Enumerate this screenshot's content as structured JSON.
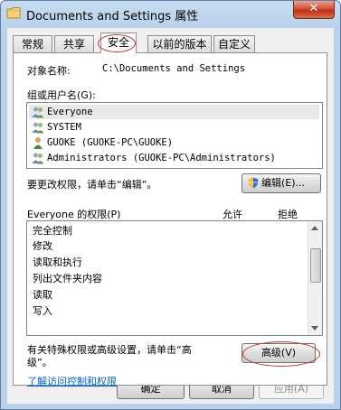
{
  "window": {
    "title": "Documents and Settings 属性",
    "close_label": "✕"
  },
  "tabs": [
    {
      "label": "常规"
    },
    {
      "label": "共享"
    },
    {
      "label": "安全"
    },
    {
      "label": "以前的版本"
    },
    {
      "label": "自定义"
    }
  ],
  "security": {
    "object_name_label": "对象名称:",
    "object_name_value": "C:\\Documents and Settings",
    "groups_label": "组或用户名(G):",
    "users": [
      {
        "name": "Everyone",
        "icon": "group-users-icon"
      },
      {
        "name": "SYSTEM",
        "icon": "group-users-icon"
      },
      {
        "name": "GUOKE (GUOKE-PC\\GUOKE)",
        "icon": "user-icon"
      },
      {
        "name": "Administrators (GUOKE-PC\\Administrators)",
        "icon": "group-users-icon"
      }
    ],
    "change_perm_text": "要更改权限，请单击“编辑”。",
    "edit_button": "编辑(E)...",
    "permissions_label": "Everyone 的权限(P)",
    "allow_header": "允许",
    "deny_header": "拒绝",
    "permissions": [
      {
        "name": "完全控制"
      },
      {
        "name": "修改"
      },
      {
        "name": "读取和执行"
      },
      {
        "name": "列出文件夹内容"
      },
      {
        "name": "读取"
      },
      {
        "name": "写入"
      }
    ],
    "advanced_text_line1": "有关特殊权限或高级设置，请单击“高",
    "advanced_text_line2": "级”。",
    "advanced_button": "高级(V)",
    "learn_link": "了解访问控制和权限"
  },
  "footer": {
    "ok_button": "确定",
    "cancel_button": "取消",
    "apply_button": "应用(A)"
  },
  "colors": {
    "highlight_circle": "#c03030",
    "link": "#0066cc",
    "title_bar": "#b9d1ea"
  }
}
